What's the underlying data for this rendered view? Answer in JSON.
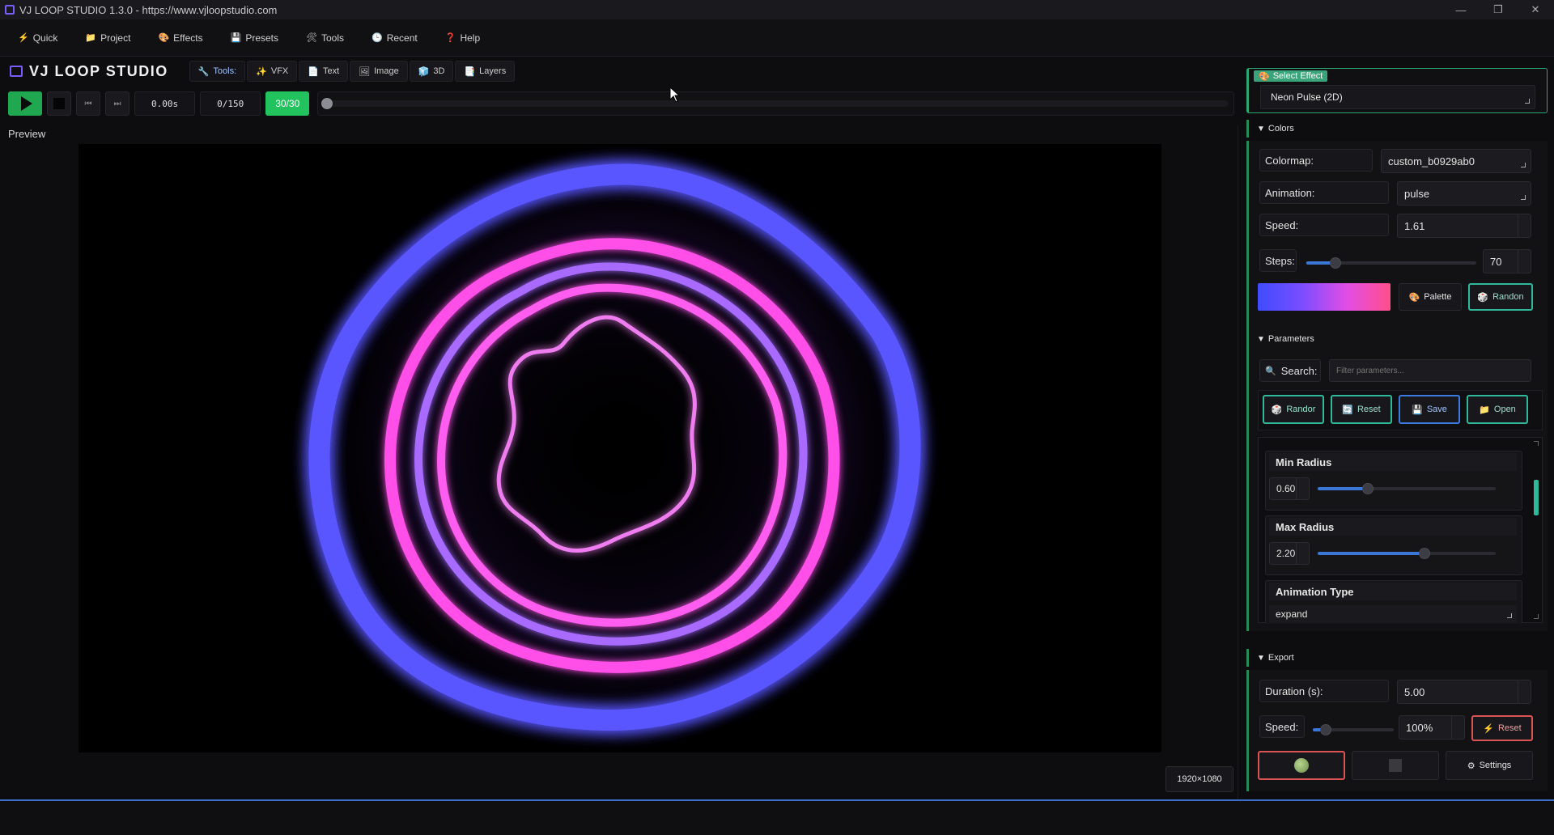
{
  "window": {
    "title": "VJ LOOP STUDIO 1.3.0 - https://www.vjloopstudio.com",
    "controls": [
      "—",
      "❐",
      "✕"
    ]
  },
  "menu": [
    {
      "icon": "⚡",
      "label": "Quick",
      "name": "menu-quick"
    },
    {
      "icon": "📁",
      "label": "Project",
      "name": "menu-project"
    },
    {
      "icon": "🎨",
      "label": "Effects",
      "name": "menu-effects"
    },
    {
      "icon": "💾",
      "label": "Presets",
      "name": "menu-presets"
    },
    {
      "icon": "🛠",
      "label": "Tools",
      "name": "menu-tools"
    },
    {
      "icon": "🕒",
      "label": "Recent",
      "name": "menu-recent"
    },
    {
      "icon": "❓",
      "label": "Help",
      "name": "menu-help"
    }
  ],
  "brand": "VJ LOOP STUDIO",
  "toolbar": {
    "tools_label": "Tools:",
    "items": [
      {
        "icon": "✨",
        "label": "VFX"
      },
      {
        "icon": "📄",
        "label": "Text"
      },
      {
        "icon": "🖼",
        "label": "Image"
      },
      {
        "icon": "🧊",
        "label": "3D"
      },
      {
        "icon": "📑",
        "label": "Layers"
      }
    ]
  },
  "transport": {
    "time": "0.00s",
    "frame": "0/150",
    "fps": "30/30",
    "position": 0
  },
  "preview": {
    "label": "Preview",
    "resolution": "1920×1080"
  },
  "panel": {
    "select_effect": {
      "tag": "Select Effect",
      "tag_icon": "🎨",
      "value": "Neon Pulse (2D)"
    },
    "colors": {
      "header": "Colors",
      "colormap_label": "Colormap:",
      "colormap_value": "custom_b0929ab0",
      "animation_label": "Animation:",
      "animation_value": "pulse",
      "speed_label": "Speed:",
      "speed_value": "1.61",
      "steps_label": "Steps:",
      "steps_value": "70",
      "steps_fraction": 0.17,
      "palette_label": "Palette",
      "palette_icon": "🎨",
      "random_label": "Randon",
      "random_icon": "🎲",
      "gradient_colors": [
        "#3f4cff",
        "#7a4dff",
        "#e24de6",
        "#ff4f8a"
      ]
    },
    "parameters": {
      "header": "Parameters",
      "search_label": "Search:",
      "search_icon": "🔍",
      "search_placeholder": "Filter parameters...",
      "buttons": [
        {
          "icon": "🎲",
          "label": "Randor",
          "style": "teal"
        },
        {
          "icon": "🔄",
          "label": "Reset",
          "style": "teal"
        },
        {
          "icon": "💾",
          "label": "Save",
          "style": "blue"
        },
        {
          "icon": "📁",
          "label": "Open",
          "style": "teal"
        }
      ],
      "items": [
        {
          "title": "Min Radius",
          "value": "0.60",
          "fraction": 0.28
        },
        {
          "title": "Max Radius",
          "value": "2.20",
          "fraction": 0.6
        }
      ],
      "animation_type": {
        "title": "Animation Type",
        "value": "expand"
      }
    },
    "export": {
      "header": "Export",
      "duration_label": "Duration (s):",
      "duration_value": "5.00",
      "speed_label": "Speed:",
      "speed_value": "100%",
      "speed_fraction": 0.16,
      "reset_label": "Reset",
      "reset_icon": "⚡",
      "settings_label": "Settings",
      "settings_icon": "⚙"
    }
  },
  "colors": {
    "accent_green": "#22c25e",
    "accent_teal": "#2fb89a",
    "accent_blue": "#3b7be0",
    "ring_blue": "#5b5cff",
    "ring_pink": "#ff5ce6"
  }
}
